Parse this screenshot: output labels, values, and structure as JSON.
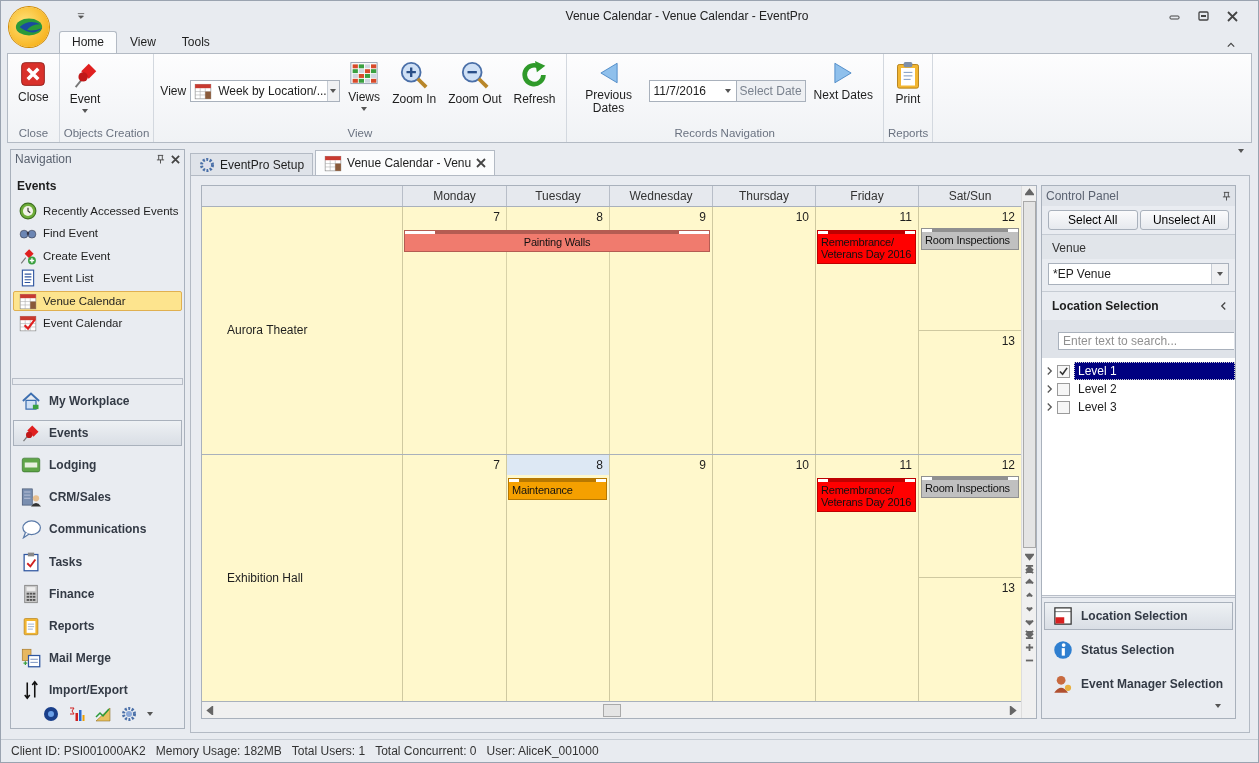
{
  "window": {
    "title": "Venue Calendar - Venue Calendar - EventPro"
  },
  "ribbon": {
    "tabs": [
      {
        "label": "Home",
        "selected": true
      },
      {
        "label": "View",
        "selected": false
      },
      {
        "label": "Tools",
        "selected": false
      }
    ],
    "groups": [
      {
        "label": "Close",
        "items": [
          {
            "kind": "button",
            "label": "Close"
          }
        ]
      },
      {
        "label": "Objects Creation",
        "items": [
          {
            "kind": "menu",
            "label": "Event"
          }
        ]
      },
      {
        "label": "View",
        "items": [
          {
            "kind": "combo",
            "label": "View",
            "value": "Week by Location/..."
          },
          {
            "kind": "menu",
            "label": "Views"
          },
          {
            "kind": "button",
            "label": "Zoom In"
          },
          {
            "kind": "button",
            "label": "Zoom Out"
          },
          {
            "kind": "button",
            "label": "Refresh"
          }
        ]
      },
      {
        "label": "Records Navigation",
        "items": [
          {
            "kind": "button",
            "label": "Previous Dates"
          },
          {
            "kind": "date",
            "value": "11/7/2016",
            "button": "Select Date"
          },
          {
            "kind": "button",
            "label": "Next Dates"
          }
        ]
      },
      {
        "label": "Reports",
        "items": [
          {
            "kind": "button",
            "label": "Print"
          }
        ]
      }
    ]
  },
  "navigation": {
    "title": "Navigation",
    "section": "Events",
    "items": [
      {
        "label": "Recently Accessed Events",
        "selected": false
      },
      {
        "label": "Find Event",
        "selected": false
      },
      {
        "label": "Create Event",
        "selected": false
      },
      {
        "label": "Event List",
        "selected": false
      },
      {
        "label": "Venue Calendar",
        "selected": true
      },
      {
        "label": "Event Calendar",
        "selected": false
      }
    ],
    "modules": [
      {
        "label": "My Workplace",
        "selected": false
      },
      {
        "label": "Events",
        "selected": true
      },
      {
        "label": "Lodging",
        "selected": false
      },
      {
        "label": "CRM/Sales",
        "selected": false
      },
      {
        "label": "Communications",
        "selected": false
      },
      {
        "label": "Tasks",
        "selected": false
      },
      {
        "label": "Finance",
        "selected": false
      },
      {
        "label": "Reports",
        "selected": false
      },
      {
        "label": "Mail Merge",
        "selected": false
      },
      {
        "label": "Import/Export",
        "selected": false
      }
    ]
  },
  "document_tabs": [
    {
      "label": "EventPro Setup",
      "selected": false
    },
    {
      "label": "Venue Calendar - Venu",
      "selected": true
    }
  ],
  "calendar": {
    "columns": [
      "Monday",
      "Tuesday",
      "Wednesday",
      "Thursday",
      "Friday",
      "Sat/Sun"
    ],
    "locations": [
      {
        "name": "Aurora Theater",
        "days": [
          {
            "kind": "weekday",
            "date": "7",
            "highlighted": false,
            "events": [
              {
                "title": "Painting Walls",
                "color": "#f07b6e"
              }
            ]
          },
          {
            "kind": "weekday",
            "date": "8",
            "highlighted": false,
            "continued": true
          },
          {
            "kind": "weekday",
            "date": "9",
            "highlighted": false,
            "continued": true
          },
          {
            "kind": "weekday",
            "date": "10",
            "highlighted": false
          },
          {
            "kind": "weekday",
            "date": "11",
            "highlighted": false,
            "events": [
              {
                "title": "Remembrance/ Veterans Day 2016",
                "color": "#ff0000"
              }
            ]
          },
          {
            "kind": "saturday",
            "date": "12",
            "highlighted": false,
            "events": [
              {
                "title": "Room Inspections",
                "color": "#c0c0c0"
              }
            ]
          },
          {
            "kind": "sunday",
            "date": "13",
            "highlighted": false
          }
        ]
      },
      {
        "name": "Exhibition Hall",
        "days": [
          {
            "kind": "weekday",
            "date": "7",
            "highlighted": false
          },
          {
            "kind": "weekday",
            "date": "8",
            "highlighted": true,
            "events": [
              {
                "title": "Maintenance",
                "color": "#f5a000"
              }
            ]
          },
          {
            "kind": "weekday",
            "date": "9",
            "highlighted": false
          },
          {
            "kind": "weekday",
            "date": "10",
            "highlighted": false
          },
          {
            "kind": "weekday",
            "date": "11",
            "highlighted": false,
            "events": [
              {
                "title": "Remembrance/ Veterans Day 2016",
                "color": "#ff0000"
              }
            ]
          },
          {
            "kind": "saturday",
            "date": "12",
            "highlighted": false,
            "events": [
              {
                "title": "Room Inspections",
                "color": "#c0c0c0"
              }
            ]
          },
          {
            "kind": "sunday",
            "date": "13",
            "highlighted": false
          }
        ]
      }
    ]
  },
  "control_panel": {
    "title": "Control Panel",
    "buttons": [
      "Select All",
      "Unselect All"
    ],
    "venue_label": "Venue",
    "venue_value": "*EP Venue",
    "section": "Location Selection",
    "search": {
      "placeholder": "Enter text to search..."
    },
    "tree": [
      {
        "label": "Level 1",
        "checked": true,
        "selected": true
      },
      {
        "label": "Level 2",
        "checked": false,
        "selected": false
      },
      {
        "label": "Level 3",
        "checked": false,
        "selected": false
      }
    ],
    "selections": [
      {
        "label": "Location Selection",
        "selected": true
      },
      {
        "label": "Status Selection",
        "selected": false
      },
      {
        "label": "Event Manager Selection",
        "selected": false
      }
    ]
  },
  "status_bar": [
    "Client ID: PSI001000AK2",
    "Memory Usage: 182MB",
    "Total Users: 1",
    "Total Concurrent: 0",
    "User: AliceK_001000"
  ]
}
